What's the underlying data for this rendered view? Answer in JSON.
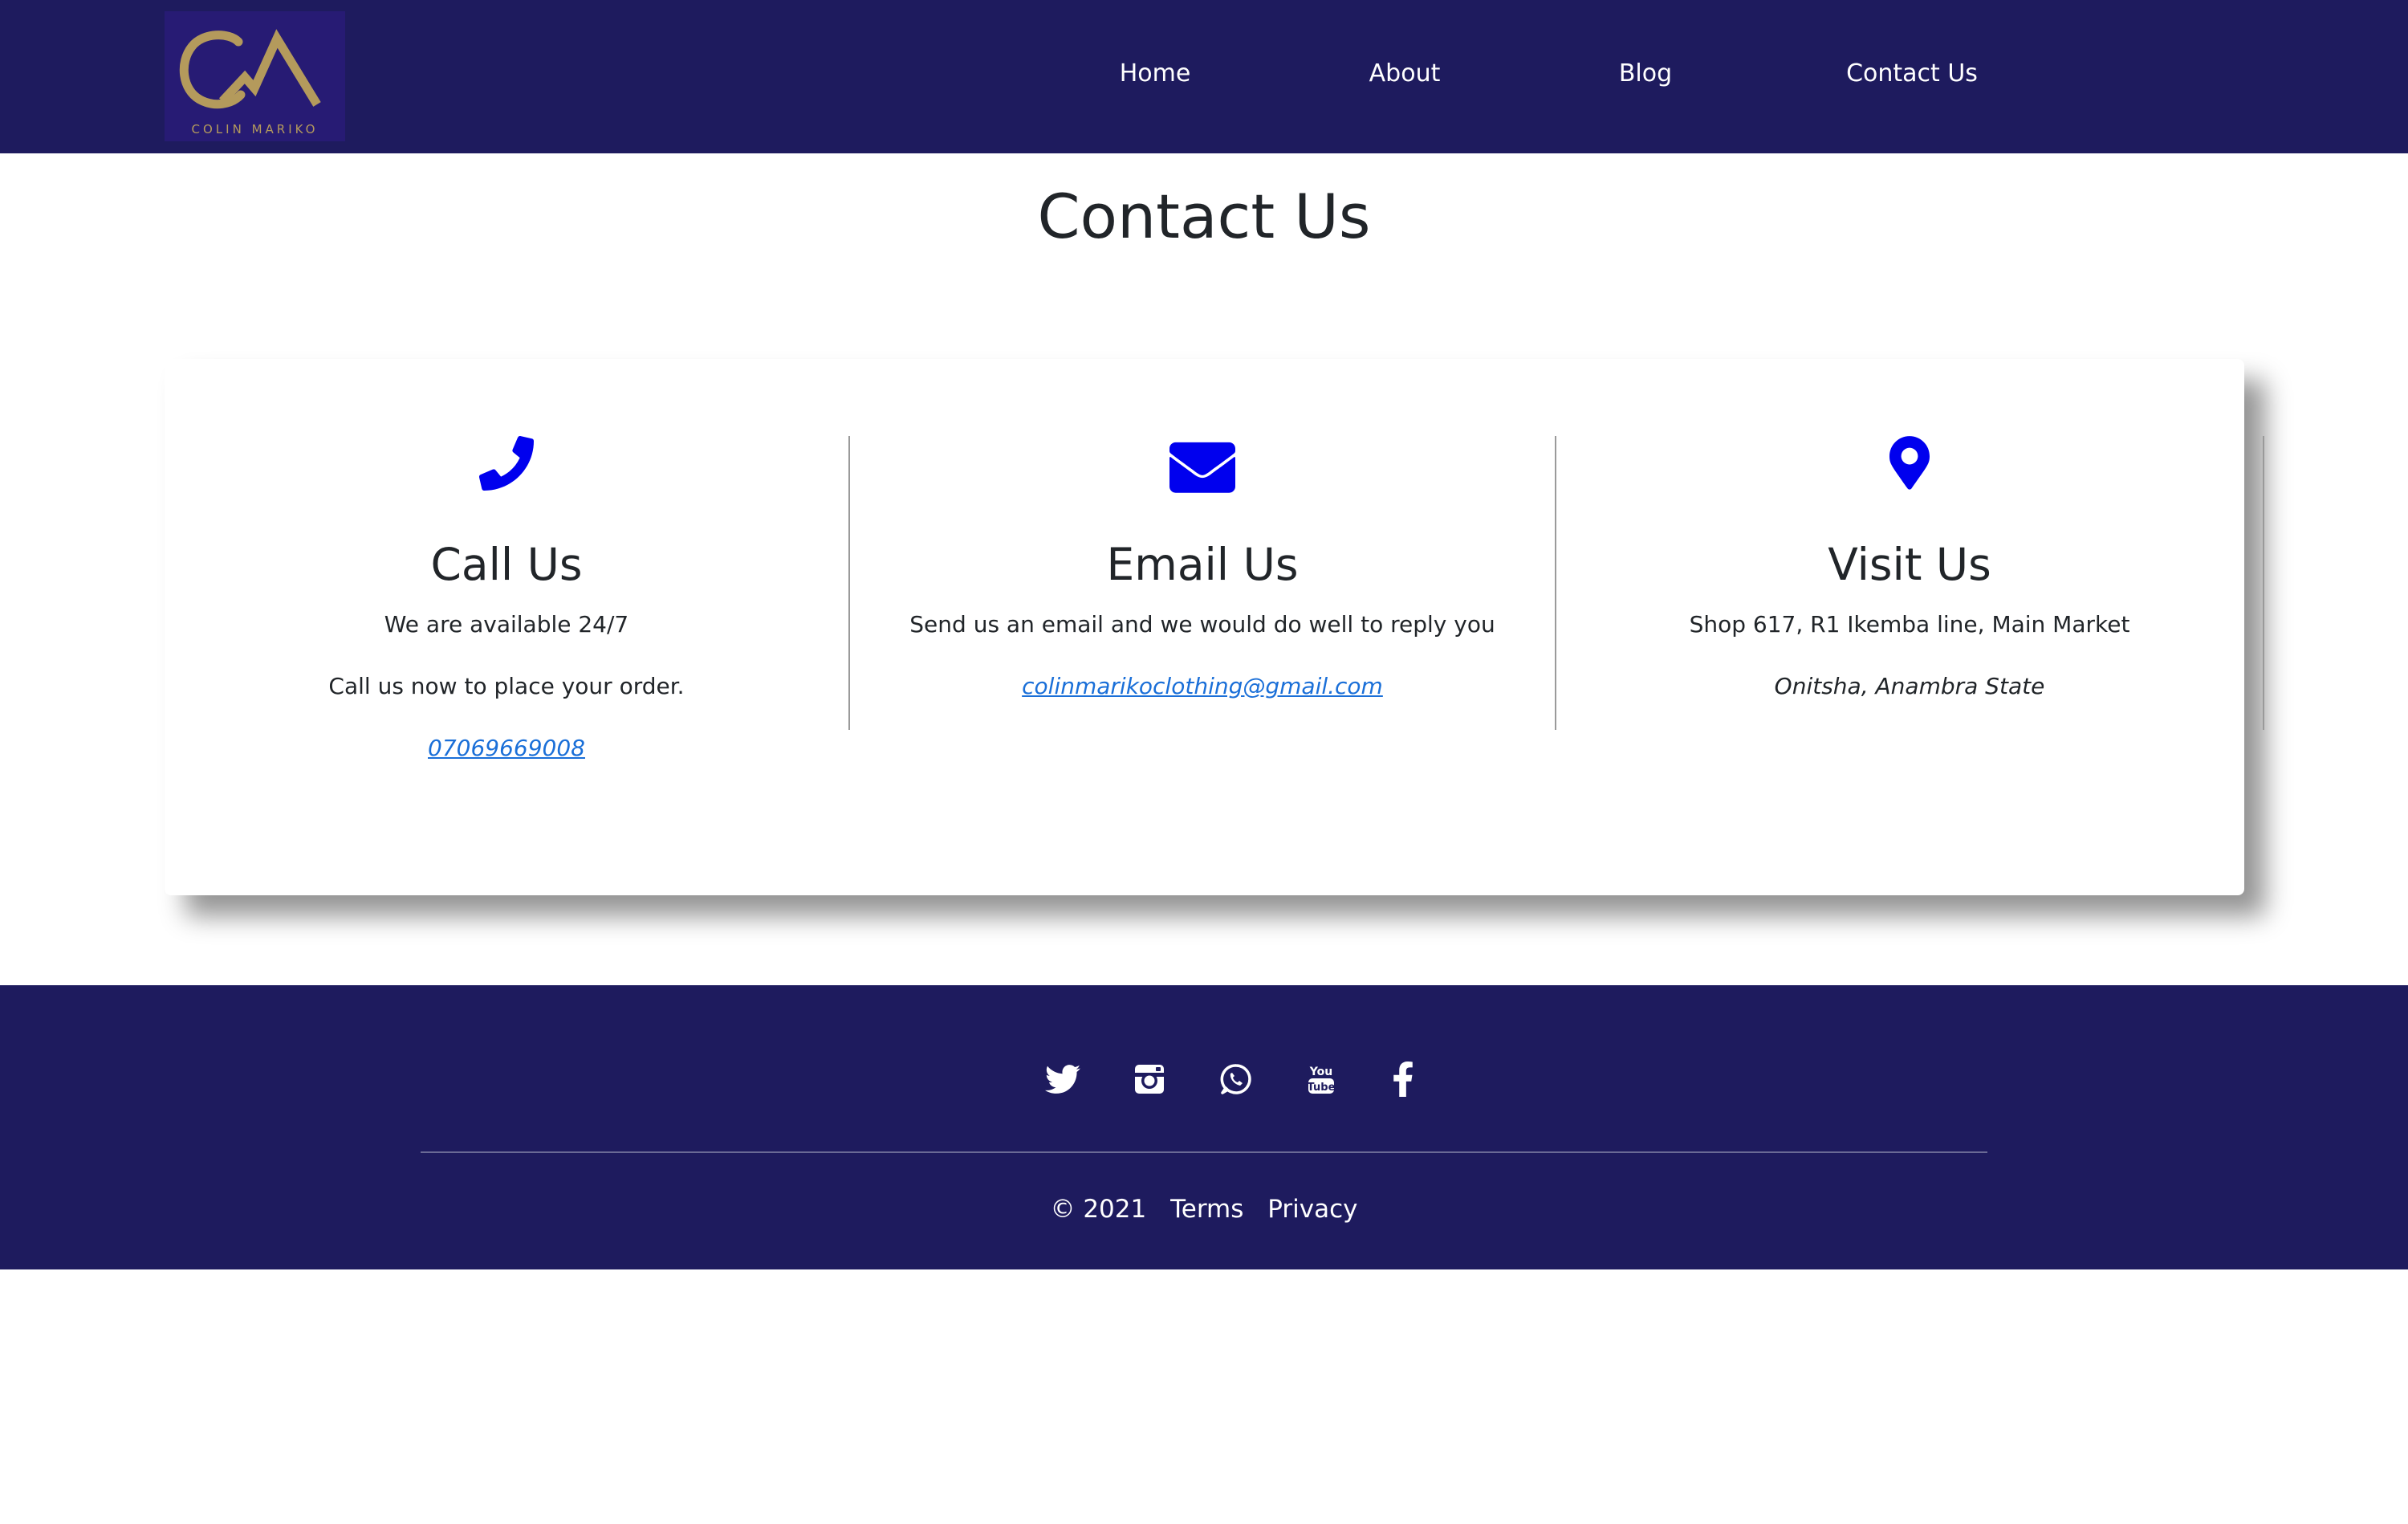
{
  "brand": {
    "logo_text": "COLIN MARIKO",
    "bg_color": "#1e1b5e",
    "logo_color": "#b49a5c"
  },
  "nav": {
    "items": [
      "Home",
      "About",
      "Blog",
      "Contact Us"
    ]
  },
  "page": {
    "title": "Contact Us"
  },
  "contact": {
    "call": {
      "icon": "phone-icon",
      "title": "Call Us",
      "line1": "We are available 24/7",
      "line2": "Call us now to place your order.",
      "phone": "07069669008"
    },
    "email": {
      "icon": "envelope-icon",
      "title": "Email Us",
      "line1": "Send us an email and we would do well to reply you",
      "address": "colinmarikoclothing@gmail.com"
    },
    "visit": {
      "icon": "map-pin-icon",
      "title": "Visit Us",
      "line1": "Shop 617, R1 Ikemba line, Main Market",
      "line2": "Onitsha, Anambra State"
    },
    "icon_color": "#0000ee",
    "link_color": "#1a6fd8"
  },
  "footer": {
    "social": [
      "twitter-icon",
      "instagram-icon",
      "whatsapp-icon",
      "youtube-icon",
      "facebook-icon"
    ],
    "copyright": "© 2021",
    "terms": "Terms",
    "privacy": "Privacy"
  }
}
